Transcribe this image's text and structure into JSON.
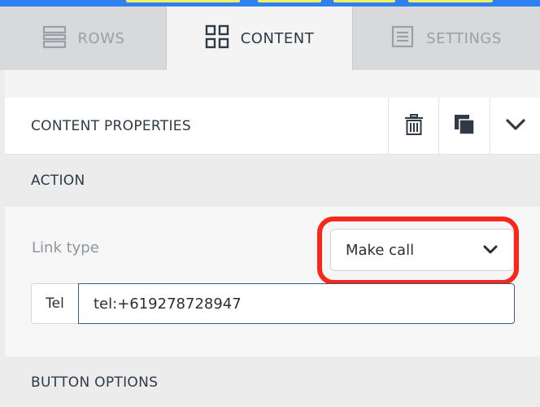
{
  "tabs": [
    {
      "label": "ROWS",
      "icon": "rows-icon"
    },
    {
      "label": "CONTENT",
      "icon": "grid-icon",
      "active": true
    },
    {
      "label": "SETTINGS",
      "icon": "settings-document-icon"
    }
  ],
  "content_properties": {
    "title": "CONTENT PROPERTIES",
    "actions": [
      "trash-icon",
      "duplicate-icon",
      "chevron-down-icon"
    ]
  },
  "action_section": {
    "title": "ACTION",
    "link_type_label": "Link type",
    "link_type_value": "Make call",
    "tel_addon": "Tel",
    "tel_value": "tel:+619278728947"
  },
  "button_options": {
    "title": "BUTTON OPTIONS"
  },
  "colors": {
    "accent_blue": "#2f80f1",
    "highlight_red": "#f7281a",
    "active_tab_bg": "#f4f4f4",
    "input_border": "#3c5a86"
  }
}
